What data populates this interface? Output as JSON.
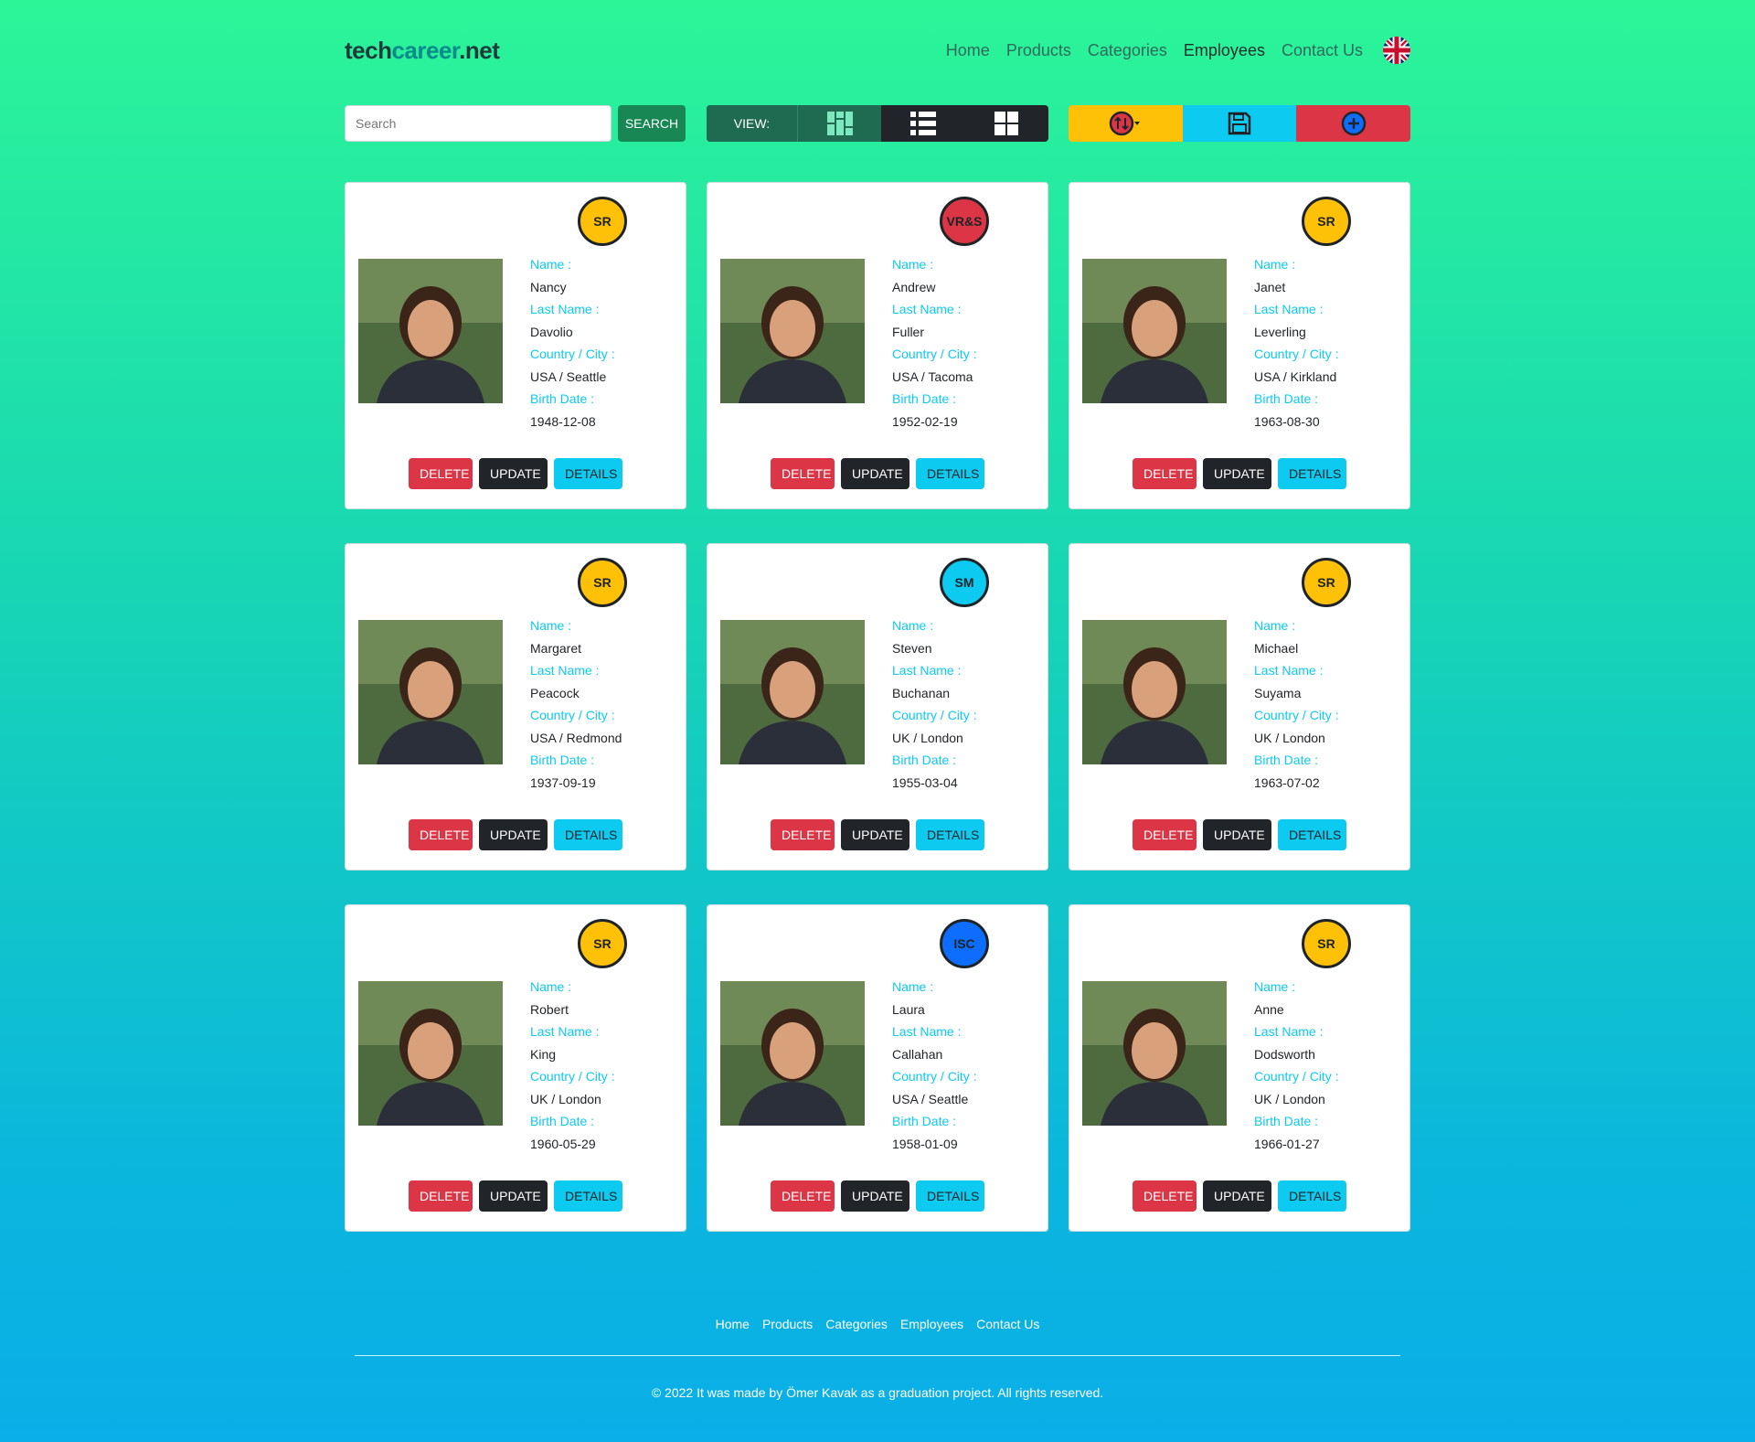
{
  "header": {
    "logo": {
      "part1": "tech",
      "part2": "career",
      "part3": ".net"
    },
    "nav": [
      "Home",
      "Products",
      "Categories",
      "Employees",
      "Contact Us"
    ],
    "active_nav": "Employees"
  },
  "toolbar": {
    "search_placeholder": "Search",
    "search_button": "SEARCH",
    "view_label": "VIEW:"
  },
  "labels": {
    "name": "Name :",
    "last_name": "Last Name :",
    "country_city": "Country / City :",
    "birth_date": "Birth Date :",
    "delete": "DELETE",
    "update": "UPDATE",
    "details": "DETAILS"
  },
  "colors": {
    "SR": "#ffc107",
    "VR&S": "#dc3545",
    "SM": "#0dcaf0",
    "ISC": "#0d6efd"
  },
  "employees": [
    {
      "badge": "SR",
      "name": "Nancy",
      "last_name": "Davolio",
      "location": "USA / Seattle",
      "birth_date": "1948-12-08"
    },
    {
      "badge": "VR&S",
      "name": "Andrew",
      "last_name": "Fuller",
      "location": "USA / Tacoma",
      "birth_date": "1952-02-19"
    },
    {
      "badge": "SR",
      "name": "Janet",
      "last_name": "Leverling",
      "location": "USA / Kirkland",
      "birth_date": "1963-08-30"
    },
    {
      "badge": "SR",
      "name": "Margaret",
      "last_name": "Peacock",
      "location": "USA / Redmond",
      "birth_date": "1937-09-19"
    },
    {
      "badge": "SM",
      "name": "Steven",
      "last_name": "Buchanan",
      "location": "UK / London",
      "birth_date": "1955-03-04"
    },
    {
      "badge": "SR",
      "name": "Michael",
      "last_name": "Suyama",
      "location": "UK / London",
      "birth_date": "1963-07-02"
    },
    {
      "badge": "SR",
      "name": "Robert",
      "last_name": "King",
      "location": "UK / London",
      "birth_date": "1960-05-29"
    },
    {
      "badge": "ISC",
      "name": "Laura",
      "last_name": "Callahan",
      "location": "USA / Seattle",
      "birth_date": "1958-01-09"
    },
    {
      "badge": "SR",
      "name": "Anne",
      "last_name": "Dodsworth",
      "location": "UK / London",
      "birth_date": "1966-01-27"
    }
  ],
  "footer": {
    "nav": [
      "Home",
      "Products",
      "Categories",
      "Employees",
      "Contact Us"
    ],
    "copyright": "© 2022 It was made by Ömer Kavak as a graduation project. All rights reserved."
  }
}
